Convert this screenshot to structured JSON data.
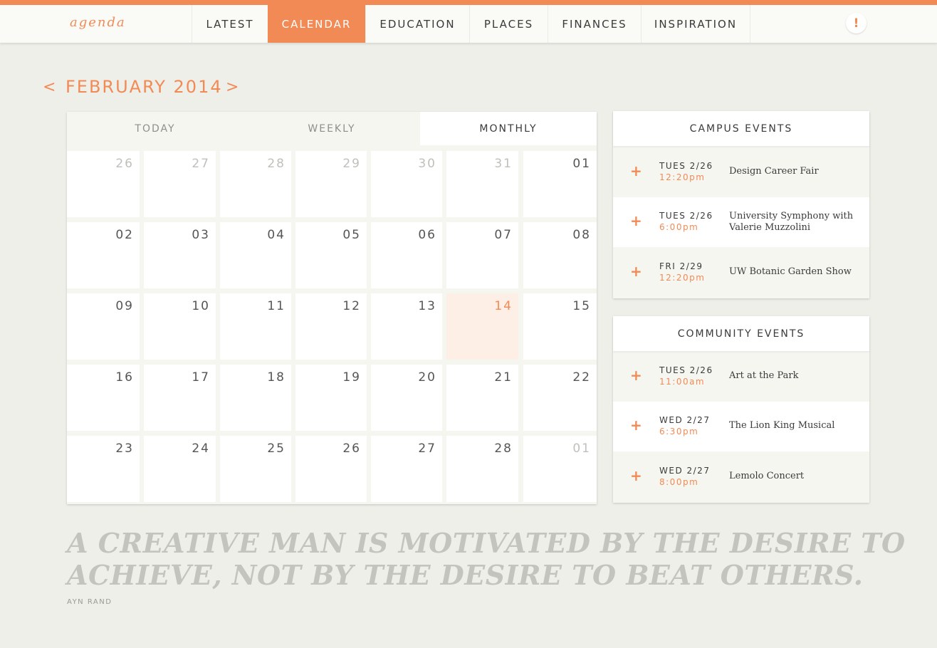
{
  "app": {
    "logo": "agenda",
    "alert_glyph": "!",
    "nav": [
      "LATEST",
      "CALENDAR",
      "EDUCATION",
      "PLACES",
      "FINANCES",
      "INSPIRATION"
    ],
    "active_nav": "CALENDAR"
  },
  "month": {
    "prev": "<",
    "title": "FEBRUARY 2014",
    "next": ">"
  },
  "calendar": {
    "views": [
      "TODAY",
      "WEEKLY",
      "MONTHLY"
    ],
    "active_view": "MONTHLY",
    "today": "14",
    "weeks": [
      [
        {
          "d": "26",
          "m": true
        },
        {
          "d": "27",
          "m": true
        },
        {
          "d": "28",
          "m": true
        },
        {
          "d": "29",
          "m": true
        },
        {
          "d": "30",
          "m": true
        },
        {
          "d": "31",
          "m": true
        },
        {
          "d": "01",
          "m": false
        }
      ],
      [
        {
          "d": "02",
          "m": false
        },
        {
          "d": "03",
          "m": false
        },
        {
          "d": "04",
          "m": false
        },
        {
          "d": "05",
          "m": false
        },
        {
          "d": "06",
          "m": false
        },
        {
          "d": "07",
          "m": false
        },
        {
          "d": "08",
          "m": false
        }
      ],
      [
        {
          "d": "09",
          "m": false
        },
        {
          "d": "10",
          "m": false
        },
        {
          "d": "11",
          "m": false
        },
        {
          "d": "12",
          "m": false
        },
        {
          "d": "13",
          "m": false
        },
        {
          "d": "14",
          "m": false
        },
        {
          "d": "15",
          "m": false
        }
      ],
      [
        {
          "d": "16",
          "m": false
        },
        {
          "d": "17",
          "m": false
        },
        {
          "d": "18",
          "m": false
        },
        {
          "d": "19",
          "m": false
        },
        {
          "d": "20",
          "m": false
        },
        {
          "d": "21",
          "m": false
        },
        {
          "d": "22",
          "m": false
        }
      ],
      [
        {
          "d": "23",
          "m": false
        },
        {
          "d": "24",
          "m": false
        },
        {
          "d": "25",
          "m": false
        },
        {
          "d": "26",
          "m": false
        },
        {
          "d": "27",
          "m": false
        },
        {
          "d": "28",
          "m": false
        },
        {
          "d": "01",
          "m": true
        }
      ]
    ]
  },
  "campus_events": {
    "title": "CAMPUS EVENTS",
    "items": [
      {
        "date": "TUES 2/26",
        "time": "12:20pm",
        "title": "Design Career Fair"
      },
      {
        "date": "TUES 2/26",
        "time": "6:00pm",
        "title": "University Symphony with Valerie Muzzolini"
      },
      {
        "date": "FRI 2/29",
        "time": "12:20pm",
        "title": "UW Botanic Garden Show"
      }
    ]
  },
  "community_events": {
    "title": "COMMUNITY EVENTS",
    "items": [
      {
        "date": "TUES 2/26",
        "time": "11:00am",
        "title": "Art at the Park"
      },
      {
        "date": "WED 2/27",
        "time": "6:30pm",
        "title": "The Lion King Musical"
      },
      {
        "date": "WED 2/27",
        "time": "8:00pm",
        "title": "Lemolo Concert"
      }
    ]
  },
  "quote": {
    "text": "A CREATIVE MAN IS MOTIVATED BY THE DESIRE TO ACHIEVE, NOT BY THE DESIRE TO BEAT OTHERS.",
    "author": "AYN RAND"
  },
  "colors": {
    "accent": "#f28a55",
    "background": "#efefea",
    "today_cell": "#fdefe6"
  }
}
